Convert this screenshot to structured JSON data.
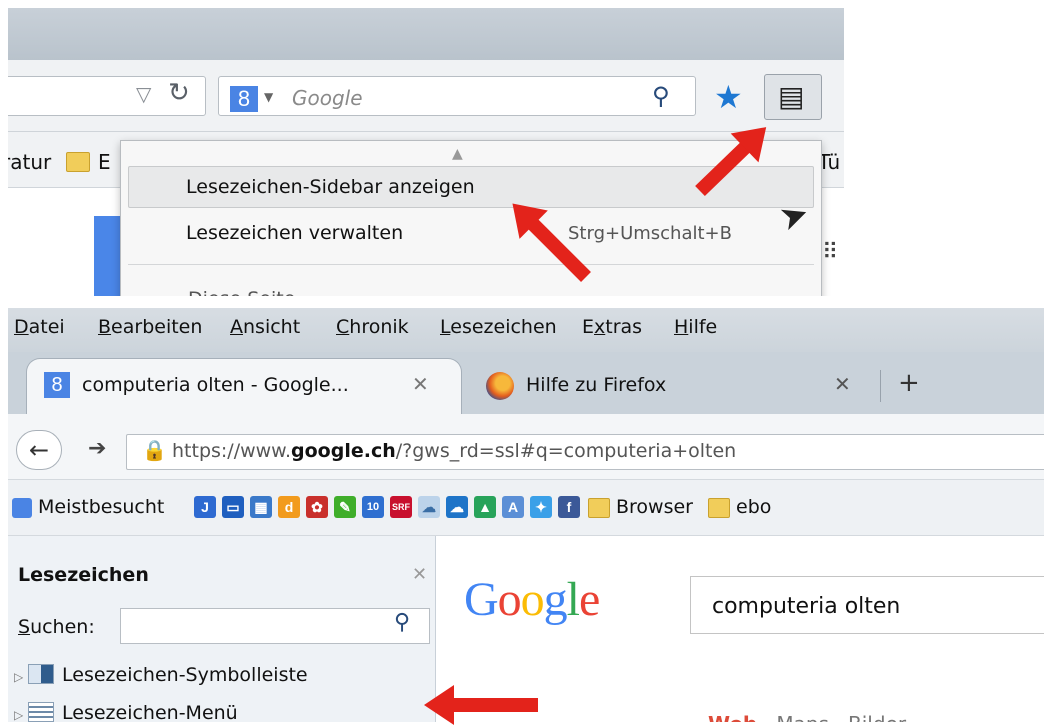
{
  "top": {
    "search_placeholder": "Google",
    "search_engine_letter": "8",
    "bookmarks_bar": {
      "left_text": "ratur",
      "folder_text": "E",
      "right_text": "Tü"
    },
    "menu": {
      "items": [
        {
          "label": "Lesezeichen-Sidebar anzeigen",
          "shortcut": ""
        },
        {
          "label": "Lesezeichen verwalten",
          "shortcut": "Strg+Umschalt+B"
        }
      ],
      "cut_text": "Diese Seite ..."
    }
  },
  "bottom": {
    "menubar": {
      "items": [
        {
          "label": "Datei",
          "accel": "D"
        },
        {
          "label": "Bearbeiten",
          "accel": "B"
        },
        {
          "label": "Ansicht",
          "accel": "A"
        },
        {
          "label": "Chronik",
          "accel": "C"
        },
        {
          "label": "Lesezeichen",
          "accel": "L"
        },
        {
          "label": "Extras",
          "accel": "x"
        },
        {
          "label": "Hilfe",
          "accel": "H"
        }
      ]
    },
    "tabs": [
      {
        "title": "computeria olten - Google...",
        "icon": "google-8-icon"
      },
      {
        "title": "Hilfe zu Firefox",
        "icon": "firefox-icon"
      }
    ],
    "url": {
      "prefix": "https://www.",
      "host": "google.ch",
      "rest": "/?gws_rd=ssl#q=computeria+olten"
    },
    "bookmarks_bar": {
      "most_visited": "Meistbesucht",
      "icon_labels": [
        "J",
        "10",
        "SRF",
        "f"
      ],
      "folders": [
        "Browser",
        "ebo"
      ]
    },
    "sidebar": {
      "title": "Lesezeichen",
      "search_label": "Suchen:",
      "search_value": "",
      "tree": [
        "Lesezeichen-Symbolleiste",
        "Lesezeichen-Menü"
      ]
    },
    "page": {
      "query": "computeria olten",
      "tabs": [
        "Web",
        "Maps",
        "Bilder"
      ]
    }
  },
  "colors": {
    "arrow": "#e3231b",
    "google_blue": "#4a84e4",
    "google_red": "#dd4b39"
  }
}
